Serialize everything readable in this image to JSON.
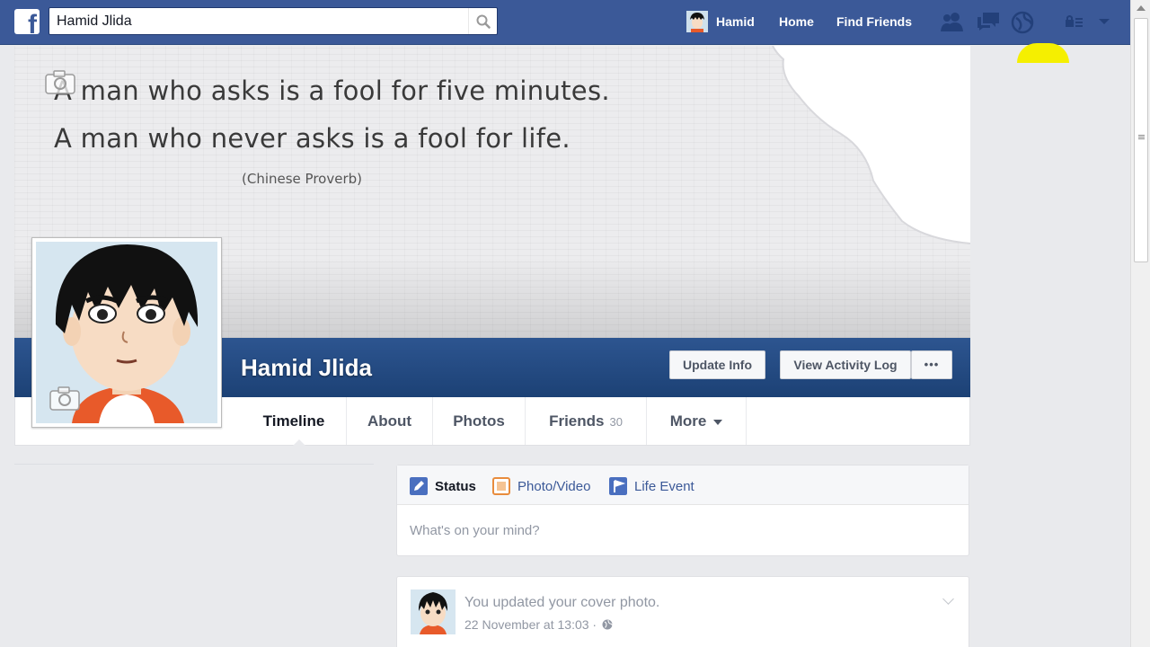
{
  "topbar": {
    "search_value": "Hamid Jlida",
    "user_name": "Hamid",
    "home_label": "Home",
    "find_friends_label": "Find Friends",
    "icons": [
      "friend-requests-icon",
      "messages-icon",
      "notifications-icon",
      "privacy-shortcuts-icon",
      "account-menu-icon"
    ]
  },
  "cover": {
    "quote_line1": "A man who asks is a fool for five minutes.",
    "quote_line2": "A man who never asks is a fool for life.",
    "source": "(Chinese Proverb)"
  },
  "profile": {
    "name": "Hamid Jlida",
    "update_info_label": "Update Info",
    "view_activity_label": "View Activity Log",
    "more_options_label": "•••"
  },
  "tabs": [
    {
      "label": "Timeline",
      "count": ""
    },
    {
      "label": "About",
      "count": ""
    },
    {
      "label": "Photos",
      "count": ""
    },
    {
      "label": "Friends",
      "count": "30"
    },
    {
      "label": "More",
      "count": ""
    }
  ],
  "composer": {
    "status_label": "Status",
    "photo_video_label": "Photo/Video",
    "life_event_label": "Life Event",
    "placeholder": "What's on your mind?"
  },
  "post": {
    "text": "You updated your cover photo.",
    "time": "22 November at 13:03 ·"
  },
  "colors": {
    "brand_blue": "#3b5998",
    "cursor_highlight": "#f5ef00"
  }
}
